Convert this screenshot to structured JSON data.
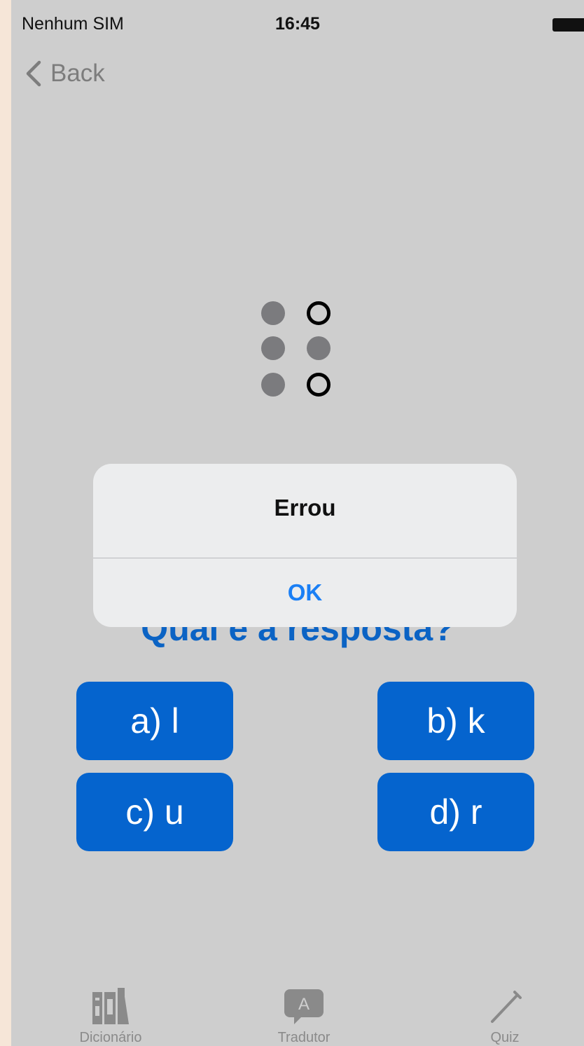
{
  "status_bar": {
    "carrier": "Nenhum SIM",
    "time": "16:45"
  },
  "nav": {
    "back_label": "Back"
  },
  "braille": {
    "dots": [
      true,
      false,
      true,
      true,
      true,
      false
    ]
  },
  "question": "Qual é a resposta?",
  "answers": [
    {
      "label": "a) l"
    },
    {
      "label": "b) k"
    },
    {
      "label": "c) u"
    },
    {
      "label": "d) r"
    }
  ],
  "alert": {
    "title": "Errou",
    "button": "OK"
  },
  "tabs": [
    {
      "label": "Dicionário",
      "icon": "books-icon"
    },
    {
      "label": "Tradutor",
      "icon": "translate-icon"
    },
    {
      "label": "Quiz",
      "icon": "pencil-icon"
    }
  ],
  "colors": {
    "accent": "#0564ce",
    "alert_button": "#1a7ff5",
    "background_dimmed": "#cecece"
  }
}
